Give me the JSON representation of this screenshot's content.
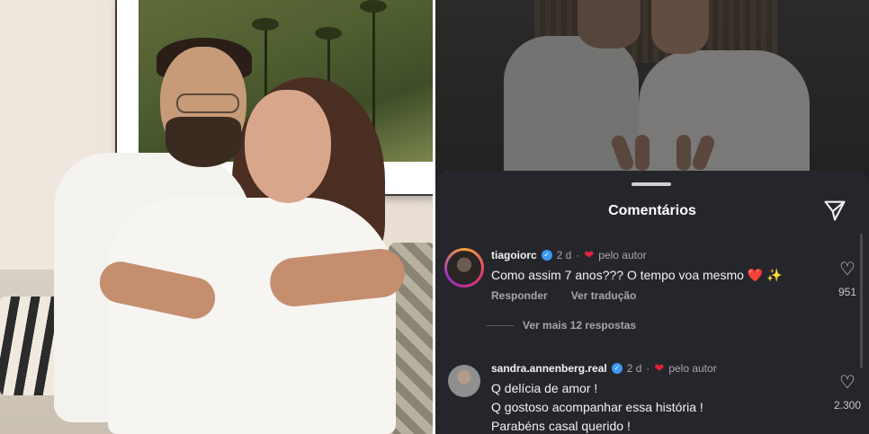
{
  "left_photo": {
    "description_icon": "couple-photo"
  },
  "sheet": {
    "title": "Comentários",
    "send_icon": "send-icon"
  },
  "comments": [
    {
      "username": "tiagoiorc",
      "age": "2 d",
      "liked_by_author_label": "pelo autor",
      "lines": [
        "Como assim 7 anos??? O tempo voa mesmo ❤️ ✨"
      ],
      "reply_label": "Responder",
      "translate_label": "Ver tradução",
      "like_count": "951"
    },
    {
      "username": "sandra.annenberg.real",
      "age": "2 d",
      "liked_by_author_label": "pelo autor",
      "lines": [
        "Q delícia de amor !",
        "Q gostoso acompanhar essa história !",
        "Parabéns casal querido !"
      ],
      "like_count": "2.300"
    }
  ],
  "more_replies": "Ver mais 12 respostas",
  "colors": {
    "sheet_bg": "#25262b",
    "verified": "#3b9af5",
    "heart": "#e0243a"
  }
}
